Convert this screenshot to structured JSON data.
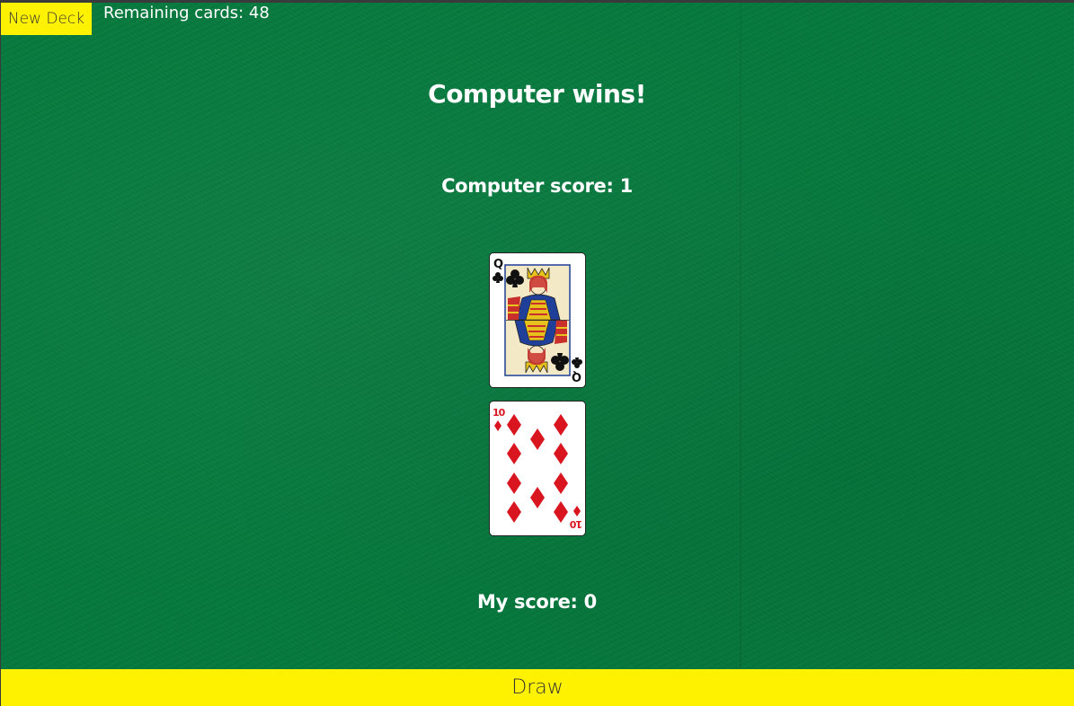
{
  "toolbar": {
    "new_deck_label": "New Deck",
    "remaining_cards": "Remaining cards: 48"
  },
  "game": {
    "result": "Computer wins!",
    "computer_score": "Computer score: 1",
    "my_score": "My score: 0"
  },
  "cards": {
    "computer": {
      "rank": "Q",
      "suit": "clubs"
    },
    "player": {
      "rank": "10",
      "suit": "diamonds"
    }
  },
  "actions": {
    "draw_label": "Draw"
  },
  "colors": {
    "felt": "#05793d",
    "button": "#fff200",
    "text": "#ffffff",
    "red_suit": "#d9161f",
    "black_suit": "#111111"
  }
}
